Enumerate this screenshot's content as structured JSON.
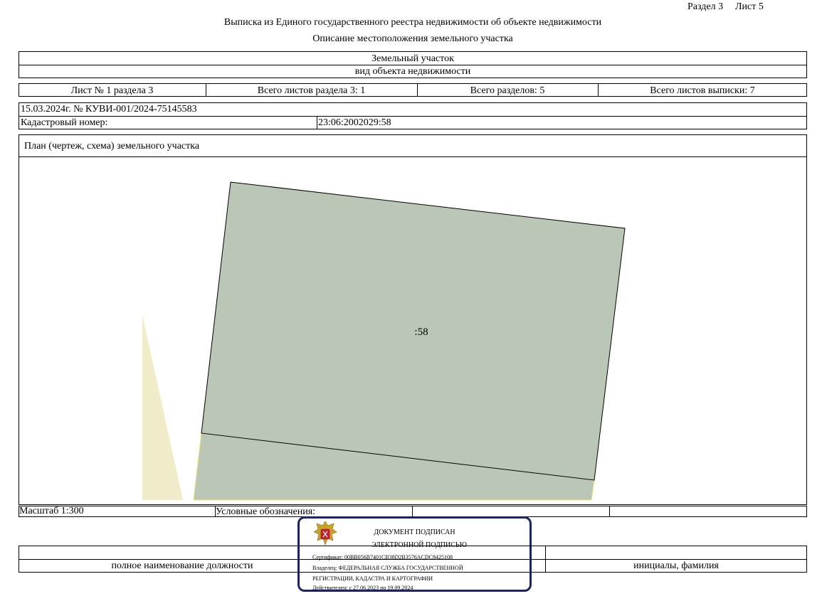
{
  "header": {
    "section": "Раздел 3",
    "sheet": "Лист 5",
    "title": "Выписка из Единого государственного реестра недвижимости об объекте недвижимости",
    "subtitle": "Описание местоположения земельного участка"
  },
  "object": {
    "name": "Земельный участок",
    "kind_caption": "вид объекта недвижимости"
  },
  "sheets_row": {
    "sheet_of_section": "Лист № 1 раздела 3",
    "total_section_sheets": "Всего листов раздела 3: 1",
    "total_sections": "Всего разделов: 5",
    "total_extract_sheets": "Всего листов выписки: 7"
  },
  "record": {
    "date_number": "15.03.2024г. № КУВИ-001/2024-75145583",
    "cadastral_label": "Кадастровый номер:",
    "cadastral_value": "23:06:2002029:58"
  },
  "plan": {
    "caption": "План (чертеж, схема) земельного участка",
    "parcel_label": ":58",
    "colors": {
      "parcel_fill": "#bbc7b6",
      "neighbor_fill": "#f0ebc8",
      "neighbor_edge": "#e8e070"
    }
  },
  "legend_row": {
    "scale": "Масштаб 1:300",
    "legend_label": "Условные обозначения:"
  },
  "signature_row": {
    "position_caption": "полное наименование должности",
    "name_caption": "инициалы, фамилия"
  },
  "stamp": {
    "line1": "ДОКУМЕНТ ПОДПИСАН",
    "line2": "ЭЛЕКТРОННОЙ ПОДПИСЬЮ",
    "certificate": "Сертификат: 00BB056B7401CB38D2B3576ACDC8425108",
    "owner_line1": "Владелец: ФЕДЕРАЛЬНАЯ СЛУЖБА ГОСУДАРСТВЕННОЙ",
    "owner_line2": "РЕГИСТРАЦИИ, КАДАСТРА И КАРТОГРАФИИ",
    "valid": "Действителен: с 27.06.2023 по 19.09.2024",
    "border_color": "#1b2466",
    "emblem_icon": "coat-of-arms-icon"
  }
}
